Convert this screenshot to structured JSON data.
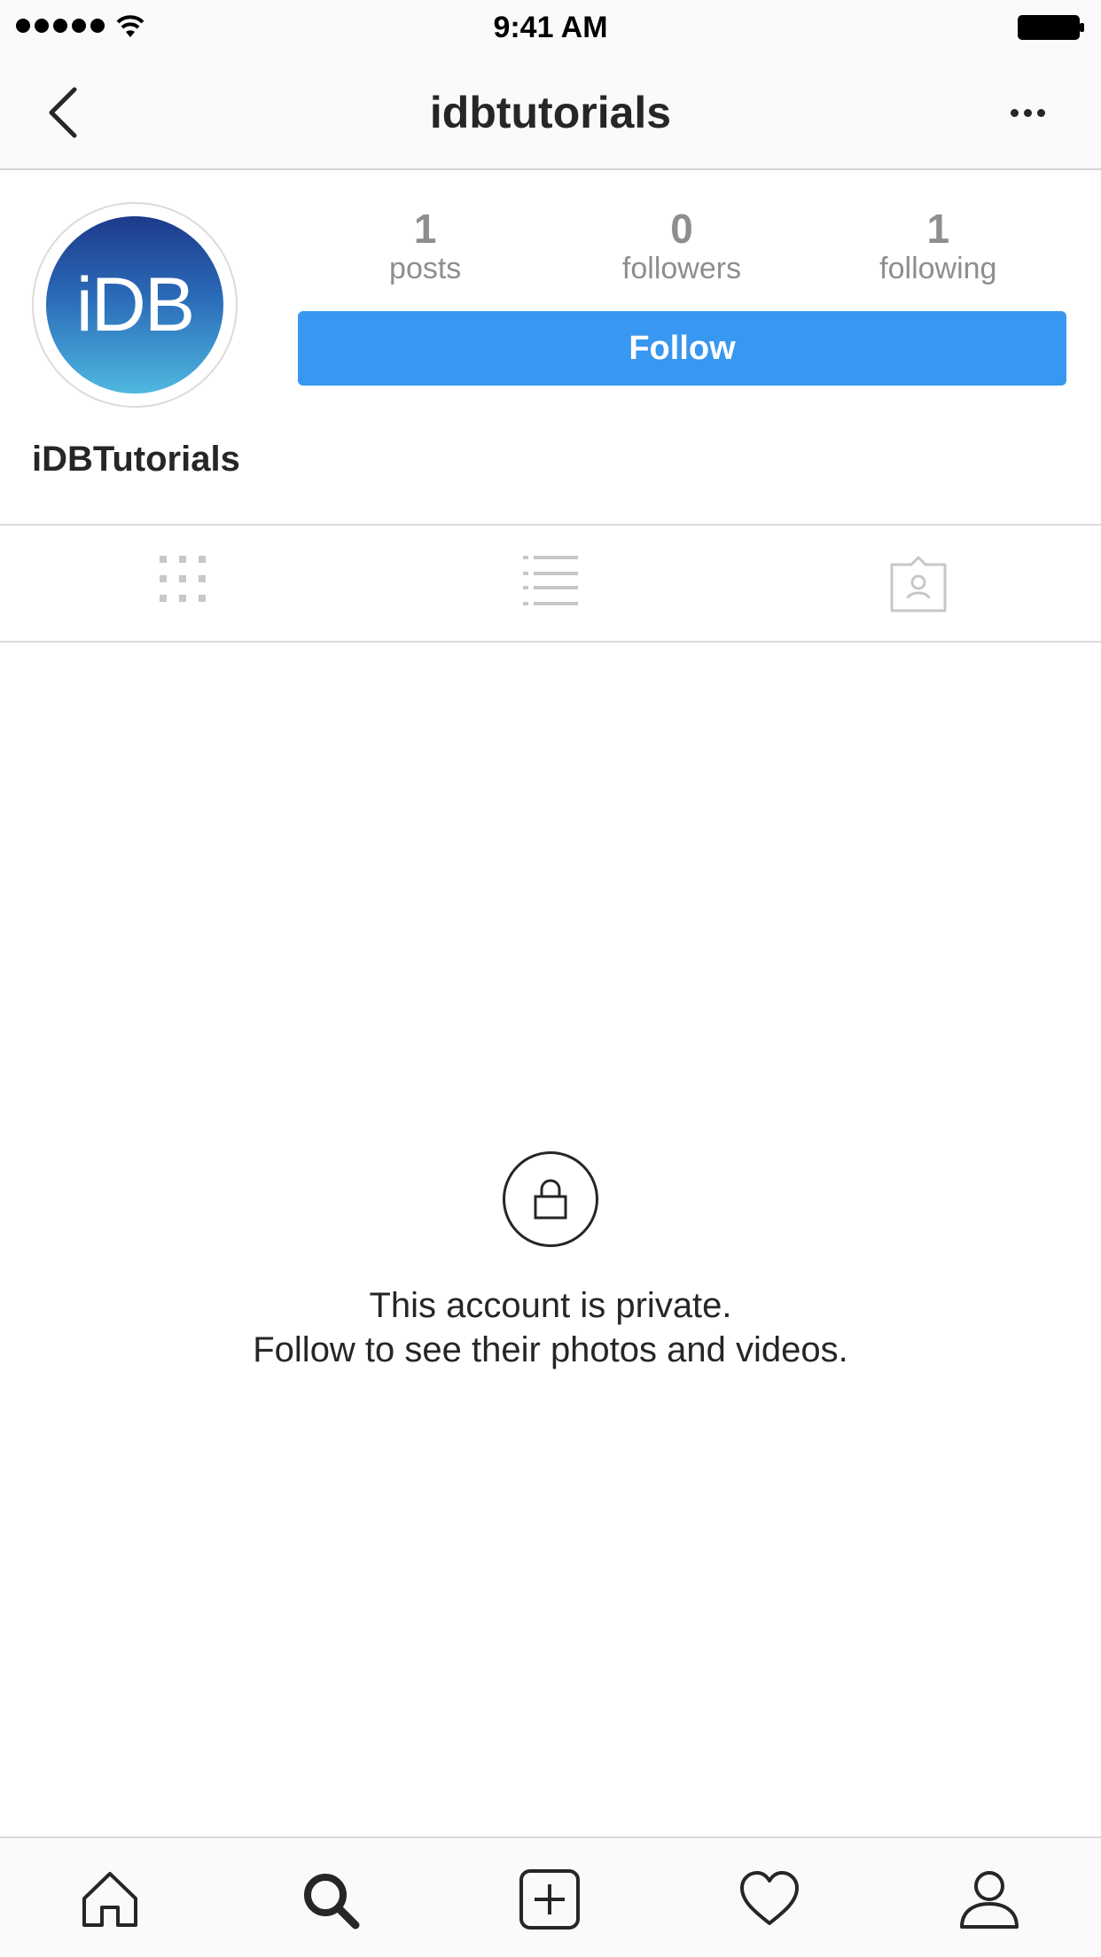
{
  "status_bar": {
    "time": "9:41 AM"
  },
  "nav": {
    "title": "idbtutorials",
    "back_icon": "chevron-left-icon",
    "more_icon": "ellipsis-icon"
  },
  "profile": {
    "avatar_text": "iDB",
    "display_name": "iDBTutorials",
    "stats": [
      {
        "value": "1",
        "label": "posts"
      },
      {
        "value": "0",
        "label": "followers"
      },
      {
        "value": "1",
        "label": "following"
      }
    ],
    "follow_label": "Follow"
  },
  "tabs": [
    {
      "icon": "grid-icon"
    },
    {
      "icon": "list-icon"
    },
    {
      "icon": "tagged-icon"
    }
  ],
  "private_notice": {
    "line1": "This account is private.",
    "line2": "Follow to see their photos and videos."
  },
  "tab_bar": [
    {
      "icon": "home-icon"
    },
    {
      "icon": "search-icon"
    },
    {
      "icon": "add-post-icon"
    },
    {
      "icon": "heart-icon"
    },
    {
      "icon": "profile-icon"
    }
  ],
  "colors": {
    "accent": "#3897f0",
    "text": "#262626",
    "muted": "#8e8e8e"
  }
}
